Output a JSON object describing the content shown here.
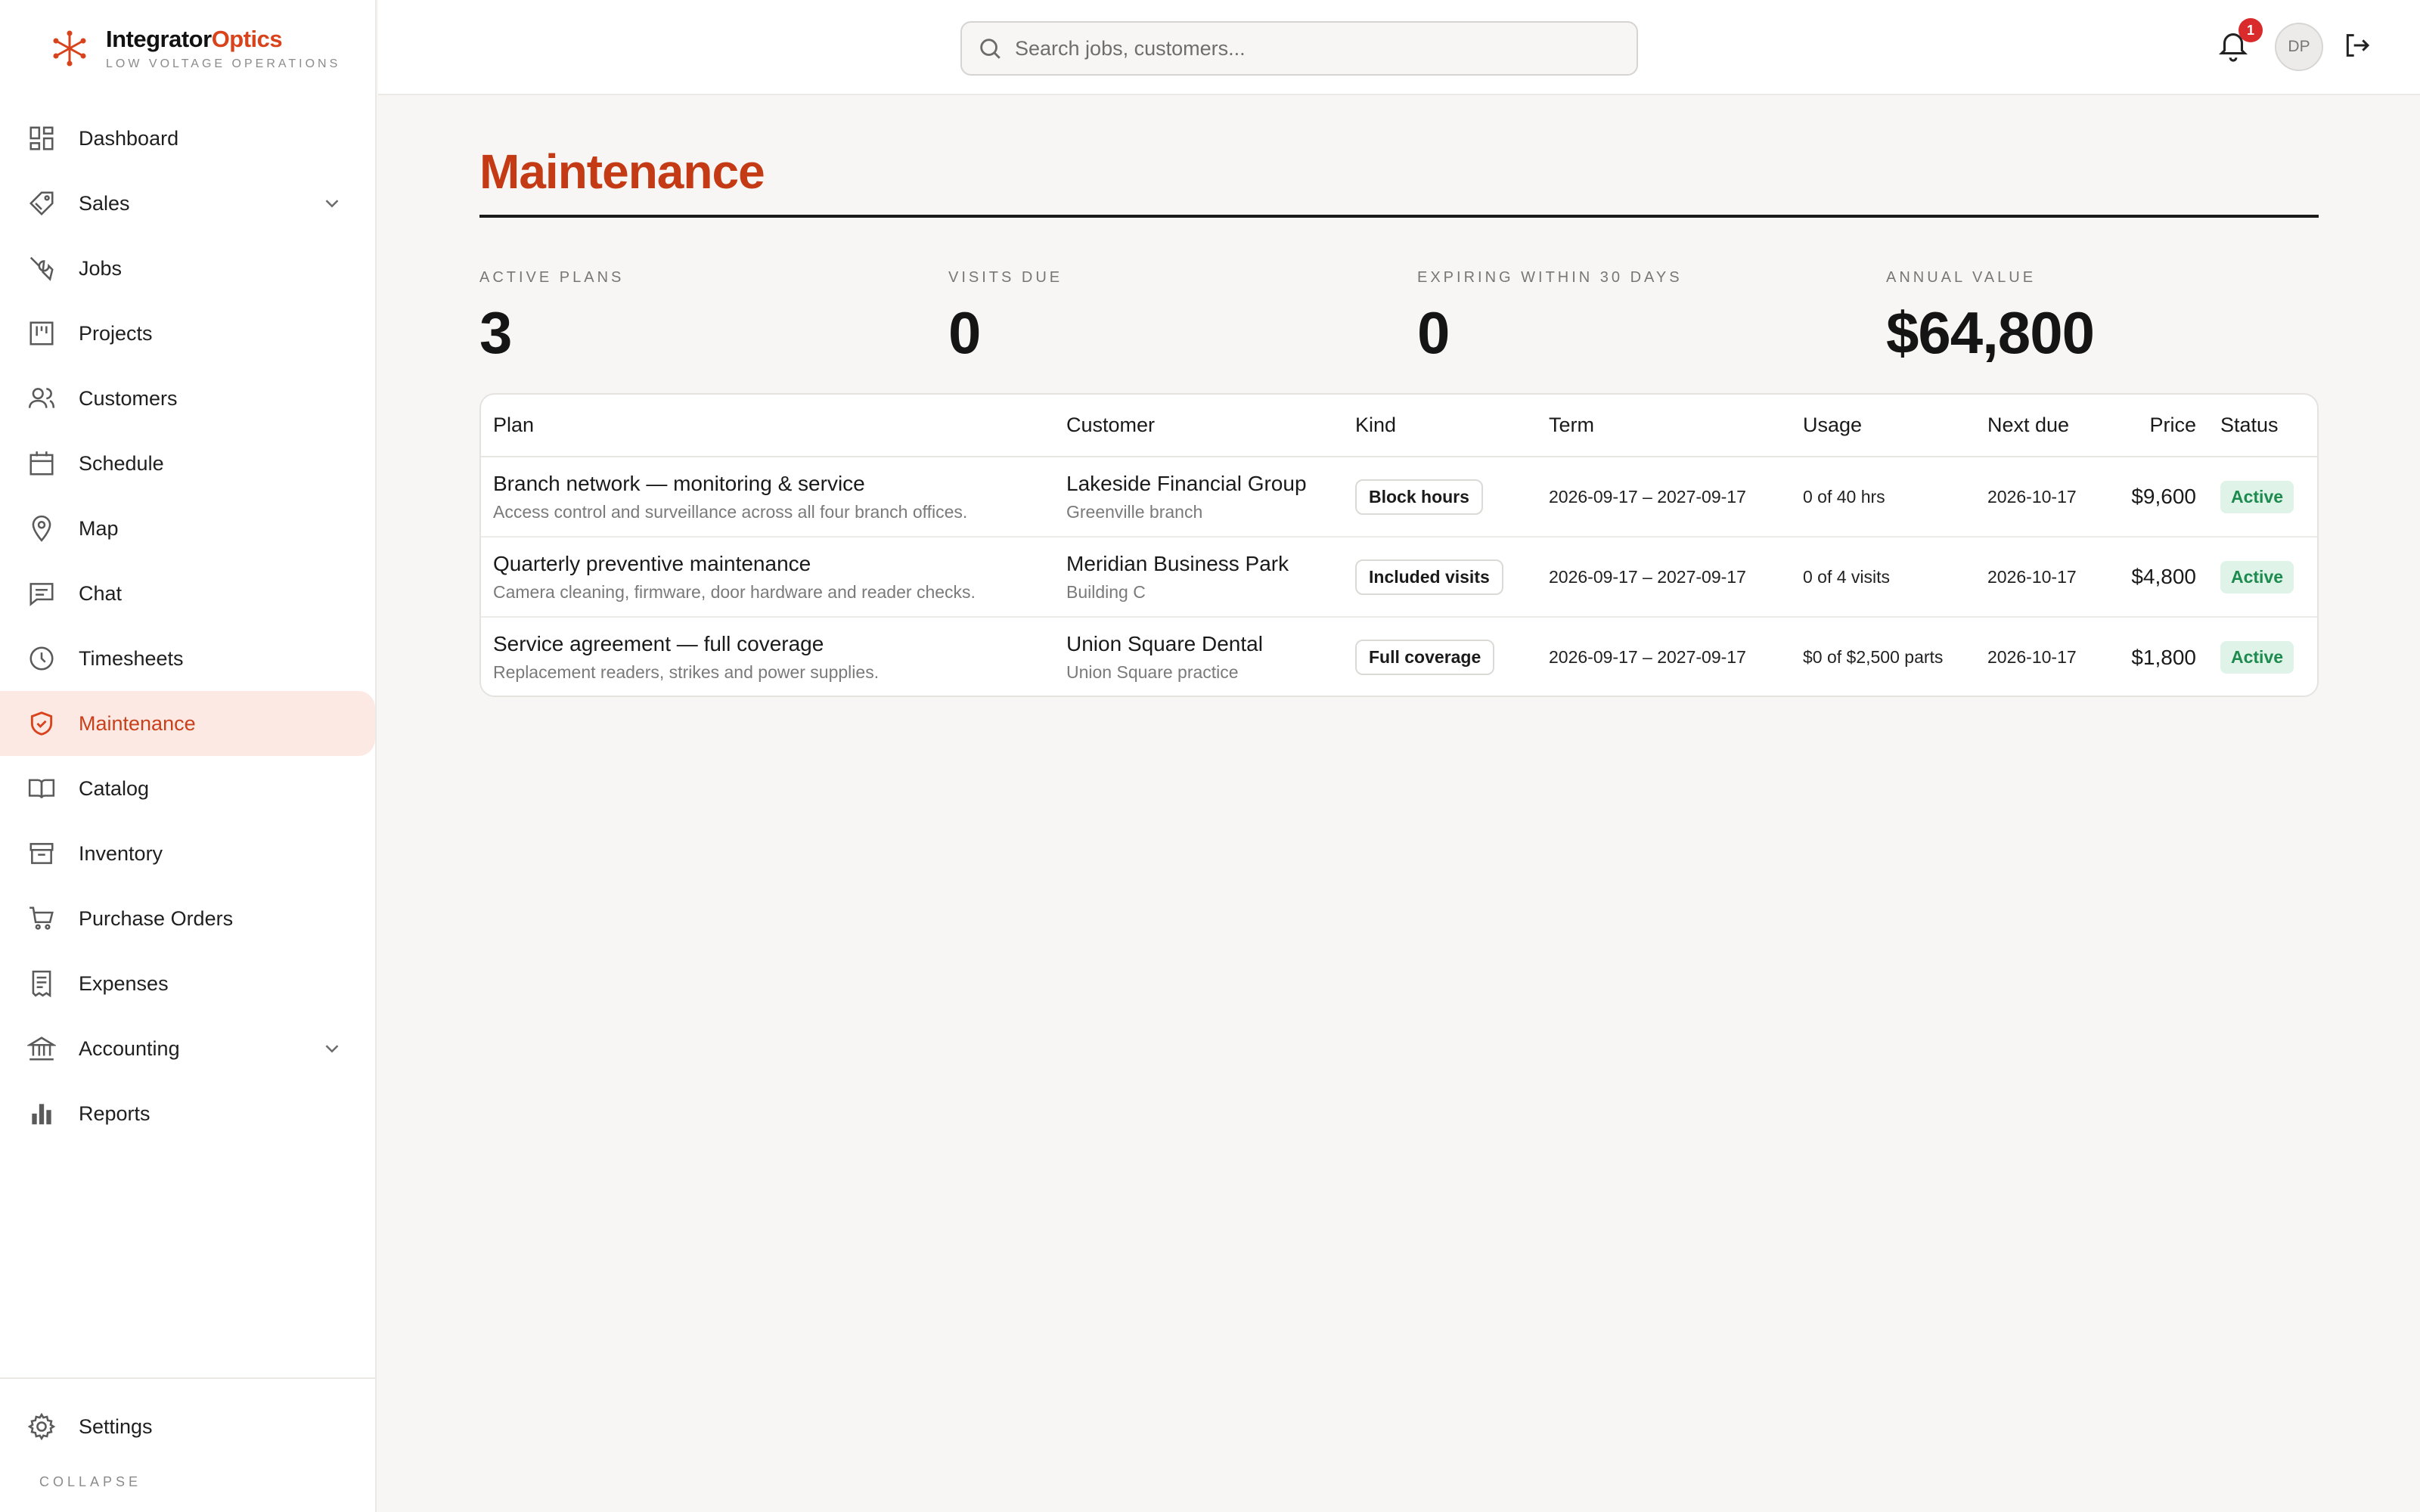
{
  "brand": {
    "name_part1": "Integrator",
    "name_part2": "Optics",
    "tagline": "LOW VOLTAGE OPERATIONS"
  },
  "sidebar": {
    "items": [
      {
        "label": "Dashboard",
        "icon": "dashboard-icon"
      },
      {
        "label": "Sales",
        "icon": "tag-icon",
        "expandable": true
      },
      {
        "label": "Jobs",
        "icon": "wrench-icon"
      },
      {
        "label": "Projects",
        "icon": "kanban-icon"
      },
      {
        "label": "Customers",
        "icon": "users-icon"
      },
      {
        "label": "Schedule",
        "icon": "calendar-icon"
      },
      {
        "label": "Map",
        "icon": "map-pin-icon"
      },
      {
        "label": "Chat",
        "icon": "chat-icon"
      },
      {
        "label": "Timesheets",
        "icon": "clock-icon"
      },
      {
        "label": "Maintenance",
        "icon": "shield-check-icon",
        "active": true
      },
      {
        "label": "Catalog",
        "icon": "book-icon"
      },
      {
        "label": "Inventory",
        "icon": "archive-icon"
      },
      {
        "label": "Purchase Orders",
        "icon": "cart-icon"
      },
      {
        "label": "Expenses",
        "icon": "receipt-icon"
      },
      {
        "label": "Accounting",
        "icon": "bank-icon",
        "expandable": true
      },
      {
        "label": "Reports",
        "icon": "bar-chart-icon"
      }
    ],
    "settings_label": "Settings",
    "collapse_label": "COLLAPSE"
  },
  "topbar": {
    "search_placeholder": "Search jobs, customers...",
    "notification_count": "1",
    "avatar_initials": "DP"
  },
  "main": {
    "title": "Maintenance",
    "stats": [
      {
        "label": "ACTIVE PLANS",
        "value": "3"
      },
      {
        "label": "VISITS DUE",
        "value": "0"
      },
      {
        "label": "EXPIRING WITHIN 30 DAYS",
        "value": "0"
      },
      {
        "label": "ANNUAL VALUE",
        "value": "$64,800"
      }
    ],
    "table": {
      "columns": [
        "Plan",
        "Customer",
        "Kind",
        "Term",
        "Usage",
        "Next due",
        "Price",
        "Status"
      ],
      "rows": [
        {
          "plan": "Branch network — monitoring & service",
          "plan_desc": "Access control and surveillance across all four branch offices.",
          "customer": "Lakeside Financial Group",
          "customer_sub": "Greenville branch",
          "kind": "Block hours",
          "term": "2026-09-17 – 2027-09-17",
          "usage": "0 of 40 hrs",
          "next_due": "2026-10-17",
          "price": "$9,600",
          "status": "Active"
        },
        {
          "plan": "Quarterly preventive maintenance",
          "plan_desc": "Camera cleaning, firmware, door hardware and reader checks.",
          "customer": "Meridian Business Park",
          "customer_sub": "Building C",
          "kind": "Included visits",
          "term": "2026-09-17 – 2027-09-17",
          "usage": "0 of 4 visits",
          "next_due": "2026-10-17",
          "price": "$4,800",
          "status": "Active"
        },
        {
          "plan": "Service agreement — full coverage",
          "plan_desc": "Replacement readers, strikes and power supplies.",
          "customer": "Union Square Dental",
          "customer_sub": "Union Square practice",
          "kind": "Full coverage",
          "term": "2026-09-17 – 2027-09-17",
          "usage": "$0 of $2,500 parts",
          "next_due": "2026-10-17",
          "price": "$1,800",
          "status": "Active"
        }
      ]
    }
  },
  "colors": {
    "accent": "#d9431b",
    "title": "#c33a15",
    "active_bg": "#fde9e3",
    "status_green": "#1d8a4e",
    "status_bg": "#dff3e8"
  }
}
